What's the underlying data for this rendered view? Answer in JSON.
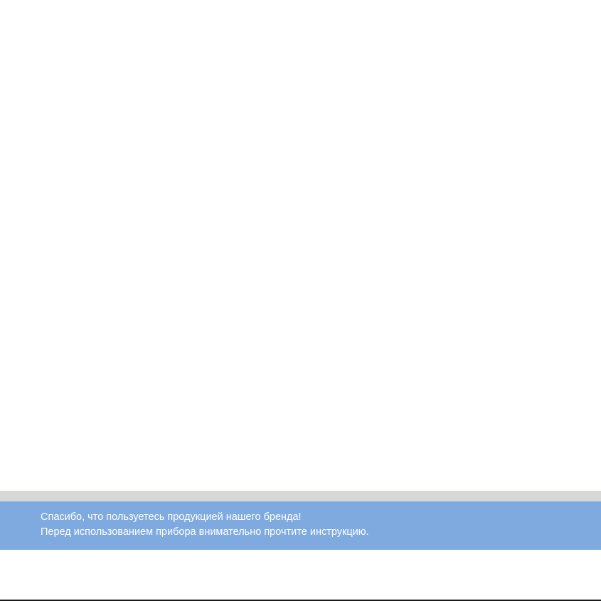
{
  "notice": {
    "line1": "Спасибо, что пользуетесь продукцией нашего бренда!",
    "line2": "Перед использованием прибора внимательно прочтите инструкцию."
  },
  "colors": {
    "background": "#ffffff",
    "stripe": "#d7d8d6",
    "band": "#7eaadf",
    "text": "#ffffff",
    "rule": "#1a1a1a"
  }
}
